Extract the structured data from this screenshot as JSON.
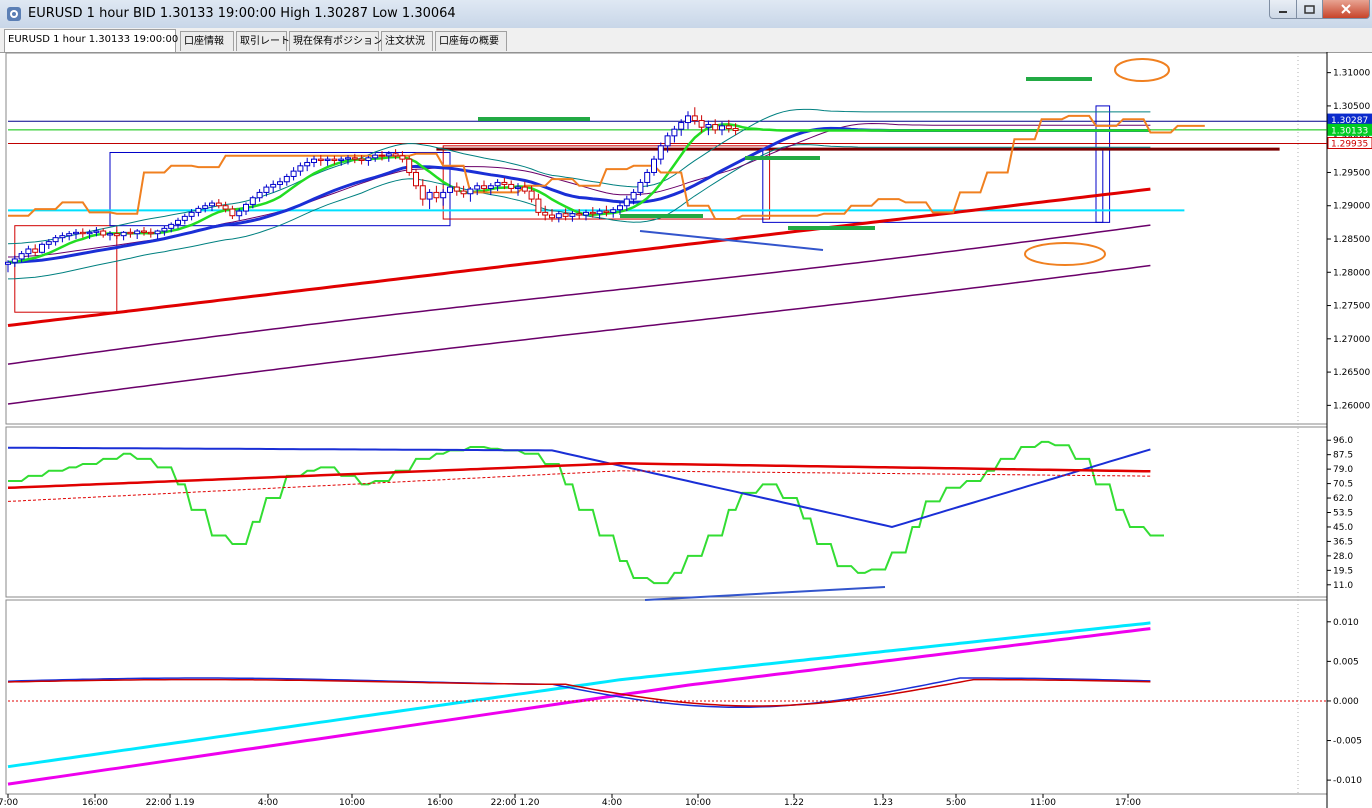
{
  "window": {
    "title": "EURUSD 1 hour BID 1.30133 19:00:00 High 1.30287 Low 1.30064"
  },
  "tabs": [
    {
      "label": "EURUSD 1 hour 1.30133 19:00:00",
      "active": true
    },
    {
      "label": "口座情報",
      "active": false
    },
    {
      "label": "取引レート",
      "active": false
    },
    {
      "label": "現在保有ポジション",
      "active": false
    },
    {
      "label": "注文状況",
      "active": false
    },
    {
      "label": "口座毎の概要",
      "active": false
    }
  ],
  "chart_data": [
    {
      "type": "line",
      "pane": "price",
      "symbol": "EURUSD",
      "ylim": [
        1.2575,
        1.3125
      ],
      "yticks": [
        "1.31000",
        "1.30500",
        "1.30000",
        "1.29500",
        "1.29000",
        "1.28500",
        "1.28000",
        "1.27500",
        "1.27000",
        "1.26500",
        "1.26000"
      ],
      "price_labels": {
        "high": "1.30287",
        "current": "1.30133",
        "lower": "1.29935"
      },
      "horizontal_lines": [
        {
          "value": 1.3027,
          "color": "#00008b"
        },
        {
          "value": 1.3014,
          "color": "#00c000"
        },
        {
          "value": 1.29935,
          "color": "#c00000"
        },
        {
          "value": 1.2985,
          "color": "#7b0000"
        },
        {
          "value": 1.2893,
          "color": "#00e0ff"
        }
      ],
      "candles": [
        [
          1.2812,
          1.2818,
          1.28,
          1.2815
        ],
        [
          1.2815,
          1.2825,
          1.2808,
          1.282
        ],
        [
          1.282,
          1.2832,
          1.2815,
          1.2828
        ],
        [
          1.2828,
          1.284,
          1.2822,
          1.2835
        ],
        [
          1.2835,
          1.2842,
          1.2825,
          1.283
        ],
        [
          1.283,
          1.2845,
          1.2828,
          1.2842
        ],
        [
          1.2842,
          1.285,
          1.2835,
          1.2846
        ],
        [
          1.2846,
          1.2856,
          1.284,
          1.2852
        ],
        [
          1.2852,
          1.286,
          1.2845,
          1.2855
        ],
        [
          1.2855,
          1.2862,
          1.2848,
          1.2858
        ],
        [
          1.2858,
          1.2865,
          1.285,
          1.286
        ],
        [
          1.286,
          1.2866,
          1.2852,
          1.2858
        ],
        [
          1.2858,
          1.2864,
          1.285,
          1.286
        ],
        [
          1.286,
          1.2868,
          1.2854,
          1.2862
        ],
        [
          1.2862,
          1.2866,
          1.2852,
          1.2856
        ],
        [
          1.2856,
          1.2862,
          1.2848,
          1.2858
        ],
        [
          1.2858,
          1.2864,
          1.285,
          1.2855
        ],
        [
          1.2855,
          1.2862,
          1.2848,
          1.286
        ],
        [
          1.286,
          1.2866,
          1.2852,
          1.2858
        ],
        [
          1.2858,
          1.2865,
          1.285,
          1.2862
        ],
        [
          1.2862,
          1.2868,
          1.2855,
          1.286
        ],
        [
          1.286,
          1.2866,
          1.2852,
          1.2858
        ],
        [
          1.2858,
          1.2864,
          1.285,
          1.2862
        ],
        [
          1.2862,
          1.287,
          1.2855,
          1.2866
        ],
        [
          1.2866,
          1.2875,
          1.286,
          1.2872
        ],
        [
          1.2872,
          1.2882,
          1.2866,
          1.2878
        ],
        [
          1.2878,
          1.2888,
          1.2872,
          1.2884
        ],
        [
          1.2884,
          1.2895,
          1.2878,
          1.289
        ],
        [
          1.289,
          1.29,
          1.2884,
          1.2896
        ],
        [
          1.2896,
          1.2905,
          1.289,
          1.29
        ],
        [
          1.29,
          1.2908,
          1.2892,
          1.2904
        ],
        [
          1.2904,
          1.291,
          1.2896,
          1.29
        ],
        [
          1.29,
          1.2906,
          1.289,
          1.2895
        ],
        [
          1.2895,
          1.29,
          1.288,
          1.2885
        ],
        [
          1.2885,
          1.2896,
          1.2878,
          1.2892
        ],
        [
          1.2892,
          1.2905,
          1.2886,
          1.2902
        ],
        [
          1.2902,
          1.2915,
          1.2896,
          1.2912
        ],
        [
          1.2912,
          1.2925,
          1.2906,
          1.292
        ],
        [
          1.292,
          1.2932,
          1.2914,
          1.2928
        ],
        [
          1.2928,
          1.2938,
          1.292,
          1.2932
        ],
        [
          1.2932,
          1.2942,
          1.2925,
          1.2936
        ],
        [
          1.2936,
          1.2948,
          1.293,
          1.2944
        ],
        [
          1.2944,
          1.2958,
          1.2938,
          1.2952
        ],
        [
          1.2952,
          1.2965,
          1.2945,
          1.296
        ],
        [
          1.296,
          1.2972,
          1.2952,
          1.2965
        ],
        [
          1.2965,
          1.2975,
          1.2958,
          1.297
        ],
        [
          1.297,
          1.2976,
          1.296,
          1.2968
        ],
        [
          1.2968,
          1.2974,
          1.296,
          1.297
        ],
        [
          1.297,
          1.2975,
          1.2962,
          1.2968
        ],
        [
          1.2968,
          1.2974,
          1.296,
          1.297
        ],
        [
          1.297,
          1.2976,
          1.2962,
          1.2972
        ],
        [
          1.2972,
          1.2978,
          1.2964,
          1.297
        ],
        [
          1.297,
          1.2976,
          1.2962,
          1.2968
        ],
        [
          1.2968,
          1.2975,
          1.296,
          1.2972
        ],
        [
          1.2972,
          1.298,
          1.2966,
          1.2976
        ],
        [
          1.2976,
          1.2982,
          1.2968,
          1.2975
        ],
        [
          1.2975,
          1.2982,
          1.2966,
          1.2978
        ],
        [
          1.2978,
          1.2985,
          1.297,
          1.2975
        ],
        [
          1.2975,
          1.2982,
          1.2965,
          1.297
        ],
        [
          1.297,
          1.2975,
          1.2945,
          1.295
        ],
        [
          1.295,
          1.2955,
          1.2925,
          1.293
        ],
        [
          1.293,
          1.294,
          1.29,
          1.291
        ],
        [
          1.291,
          1.2925,
          1.2895,
          1.292
        ],
        [
          1.292,
          1.293,
          1.2905,
          1.2912
        ],
        [
          1.2912,
          1.2925,
          1.29,
          1.292
        ],
        [
          1.292,
          1.2935,
          1.291,
          1.2928
        ],
        [
          1.2928,
          1.2935,
          1.2915,
          1.2922
        ],
        [
          1.2922,
          1.293,
          1.2912,
          1.2918
        ],
        [
          1.2918,
          1.2928,
          1.2906,
          1.2925
        ],
        [
          1.2925,
          1.2935,
          1.2916,
          1.293
        ],
        [
          1.293,
          1.2938,
          1.292,
          1.2926
        ],
        [
          1.2926,
          1.2934,
          1.2916,
          1.293
        ],
        [
          1.293,
          1.294,
          1.2922,
          1.2935
        ],
        [
          1.2935,
          1.2942,
          1.2925,
          1.2932
        ],
        [
          1.2932,
          1.2938,
          1.292,
          1.2926
        ],
        [
          1.2926,
          1.2934,
          1.2915,
          1.2928
        ],
        [
          1.2928,
          1.2936,
          1.2918,
          1.2922
        ],
        [
          1.2922,
          1.293,
          1.2905,
          1.291
        ],
        [
          1.291,
          1.2918,
          1.2885,
          1.289
        ],
        [
          1.289,
          1.29,
          1.2878,
          1.2886
        ],
        [
          1.2886,
          1.2895,
          1.2876,
          1.2882
        ],
        [
          1.2882,
          1.2892,
          1.2875,
          1.2888
        ],
        [
          1.2888,
          1.2896,
          1.2878,
          1.2884
        ],
        [
          1.2884,
          1.2892,
          1.2876,
          1.2888
        ],
        [
          1.2888,
          1.2895,
          1.288,
          1.2886
        ],
        [
          1.2886,
          1.2894,
          1.2878,
          1.289
        ],
        [
          1.289,
          1.2898,
          1.2882,
          1.2888
        ],
        [
          1.2888,
          1.2896,
          1.288,
          1.2892
        ],
        [
          1.2892,
          1.29,
          1.2884,
          1.289
        ],
        [
          1.289,
          1.2898,
          1.2882,
          1.2894
        ],
        [
          1.2894,
          1.2905,
          1.2886,
          1.29
        ],
        [
          1.29,
          1.2915,
          1.2892,
          1.291
        ],
        [
          1.291,
          1.2925,
          1.2902,
          1.292
        ],
        [
          1.292,
          1.294,
          1.2915,
          1.2935
        ],
        [
          1.2935,
          1.2955,
          1.2928,
          1.295
        ],
        [
          1.295,
          1.2975,
          1.2945,
          1.297
        ],
        [
          1.297,
          1.2995,
          1.2962,
          1.299
        ],
        [
          1.299,
          1.301,
          1.298,
          1.3005
        ],
        [
          1.3005,
          1.302,
          1.2995,
          1.3015
        ],
        [
          1.3015,
          1.303,
          1.3005,
          1.3025
        ],
        [
          1.3025,
          1.3042,
          1.3015,
          1.3035
        ],
        [
          1.3035,
          1.3048,
          1.3022,
          1.3028
        ],
        [
          1.3028,
          1.3036,
          1.301,
          1.3018
        ],
        [
          1.3018,
          1.3028,
          1.3006,
          1.3022
        ],
        [
          1.3022,
          1.303,
          1.3008,
          1.3014
        ],
        [
          1.3014,
          1.3026,
          1.3006,
          1.302
        ],
        [
          1.302,
          1.3029,
          1.301,
          1.3016
        ],
        [
          1.3016,
          1.3024,
          1.3006,
          1.3013
        ]
      ],
      "zones": [
        {
          "x": [
            1,
            16
          ],
          "y": [
            1.274,
            1.287
          ],
          "color": "#d00000"
        },
        {
          "x": [
            15,
            65
          ],
          "y": [
            1.287,
            1.298
          ],
          "color": "#0000c8"
        },
        {
          "x": [
            64,
            112
          ],
          "y": [
            1.288,
            1.299
          ],
          "color": "#d00000"
        },
        {
          "x": [
            111,
            161
          ],
          "y": [
            1.2875,
            1.2985
          ],
          "color": "#0000c8"
        },
        {
          "x": [
            160,
            162
          ],
          "y": [
            1.2875,
            1.305
          ],
          "color": "#0000c8"
        }
      ]
    },
    {
      "type": "line",
      "pane": "stochastic",
      "ylim": [
        5,
        102
      ],
      "yticks": [
        "96.0",
        "87.5",
        "79.0",
        "70.5",
        "62.0",
        "53.5",
        "45.0",
        "36.5",
        "28.0",
        "19.5",
        "11.0"
      ]
    },
    {
      "type": "line",
      "pane": "oscillator",
      "ylim": [
        -0.0115,
        0.0125
      ],
      "yticks": [
        "0.010",
        "0.005",
        "0.000",
        "-0.005",
        "-0.010"
      ],
      "zero_line": 0.0
    }
  ],
  "x_axis": {
    "labels": [
      "7:00",
      "16:00",
      "22:00 1.19",
      "4:00",
      "10:00",
      "16:00",
      "22:00 1.20",
      "4:00",
      "10:00",
      "1.22",
      "1.23",
      "5:00",
      "11:00",
      "17:00"
    ]
  }
}
